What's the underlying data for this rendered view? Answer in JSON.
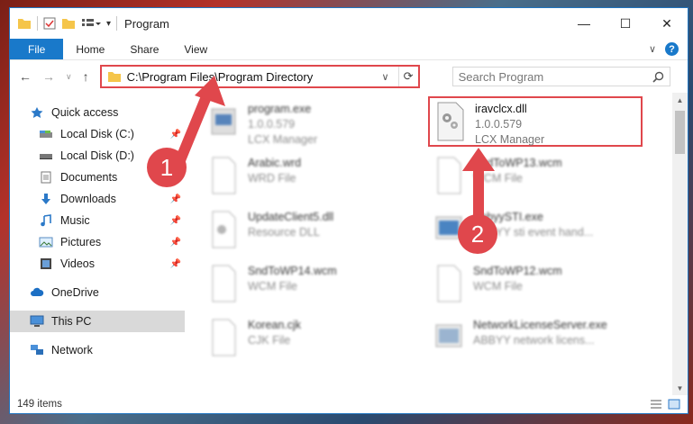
{
  "window": {
    "title": "Program",
    "controls": {
      "minimize": "—",
      "maximize": "☐",
      "close": "✕"
    }
  },
  "ribbon": {
    "tabs": [
      "File",
      "Home",
      "Share",
      "View"
    ],
    "expand": "∨",
    "help": "?"
  },
  "address": {
    "path": "C:\\Program Files\\Program Directory",
    "dropdown": "∨",
    "refresh": "⟳"
  },
  "search": {
    "placeholder": "Search Program"
  },
  "sidebar": {
    "items": [
      {
        "label": "Quick access",
        "icon": "star-icon"
      },
      {
        "label": "Local Disk (C:)",
        "icon": "drive-icon"
      },
      {
        "label": "Local Disk (D:)",
        "icon": "drive-icon"
      },
      {
        "label": "Documents",
        "icon": "documents-icon"
      },
      {
        "label": "Downloads",
        "icon": "download-icon"
      },
      {
        "label": "Music",
        "icon": "music-icon"
      },
      {
        "label": "Pictures",
        "icon": "pictures-icon"
      },
      {
        "label": "Videos",
        "icon": "videos-icon"
      },
      {
        "label": "OneDrive",
        "icon": "cloud-icon"
      },
      {
        "label": "This PC",
        "icon": "computer-icon"
      },
      {
        "label": "Network",
        "icon": "network-icon"
      }
    ]
  },
  "files": [
    {
      "name": "program.exe",
      "line2": "1.0.0.579",
      "line3": "LCX Manager"
    },
    {
      "name": "iravclcx.dll",
      "line2": "1.0.0.579",
      "line3": "LCX Manager"
    },
    {
      "name": "Arabic.wrd",
      "line2": "WRD File",
      "line3": ""
    },
    {
      "name": "SndToWP13.wcm",
      "line2": "WCM File",
      "line3": ""
    },
    {
      "name": "UpdateClient5.dll",
      "line2": "Resource DLL",
      "line3": ""
    },
    {
      "name": "AbbyySTI.exe",
      "line2": "ABBYY sti event hand...",
      "line3": ""
    },
    {
      "name": "SndToWP14.wcm",
      "line2": "WCM File",
      "line3": ""
    },
    {
      "name": "SndToWP12.wcm",
      "line2": "WCM File",
      "line3": ""
    },
    {
      "name": "Korean.cjk",
      "line2": "CJK File",
      "line3": ""
    },
    {
      "name": "NetworkLicenseServer.exe",
      "line2": "ABBYY network licens...",
      "line3": ""
    }
  ],
  "status": {
    "items": "149 items"
  },
  "callouts": [
    "1",
    "2"
  ],
  "colors": {
    "accent": "#1979ca",
    "highlight": "#e0474c"
  }
}
